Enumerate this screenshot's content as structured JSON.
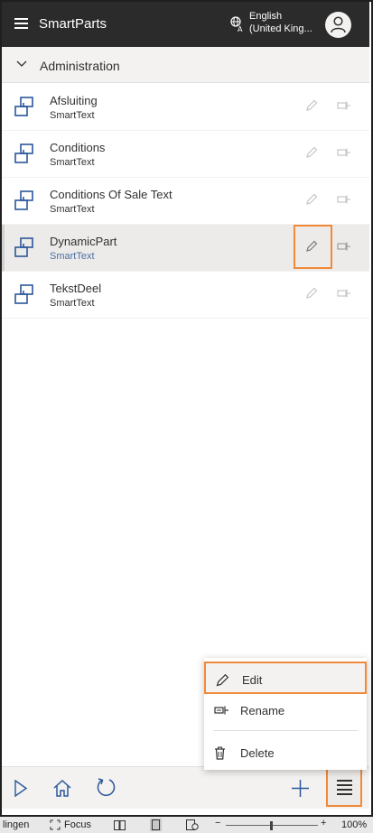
{
  "app": {
    "title": "SmartParts",
    "language_line1": "English",
    "language_line2": "(United King..."
  },
  "section": {
    "title": "Administration"
  },
  "items": [
    {
      "name": "Afsluiting",
      "type": "SmartText"
    },
    {
      "name": "Conditions",
      "type": "SmartText"
    },
    {
      "name": "Conditions Of Sale Text",
      "type": "SmartText"
    },
    {
      "name": "DynamicPart",
      "type": "SmartText"
    },
    {
      "name": "TekstDeel",
      "type": "SmartText"
    }
  ],
  "menu": {
    "edit": "Edit",
    "rename": "Rename",
    "delete": "Delete"
  },
  "statusbar": {
    "left": "lingen",
    "focus": "Focus",
    "zoom": "100%"
  },
  "colors": {
    "topbar": "#2b2b2b",
    "highlight": "#f08a3a",
    "selected_row": "#edebe9"
  }
}
